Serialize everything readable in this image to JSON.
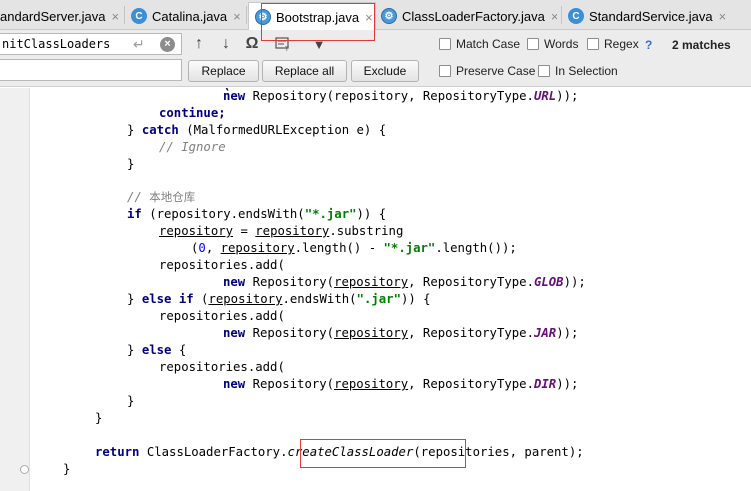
{
  "tabs": [
    {
      "label": "andardServer.java",
      "icon": "c",
      "active": false
    },
    {
      "label": "Catalina.java",
      "icon": "c",
      "active": false
    },
    {
      "label": "Bootstrap.java",
      "icon": "g",
      "active": true
    },
    {
      "label": "ClassLoaderFactory.java",
      "icon": "g",
      "active": false
    },
    {
      "label": "StandardService.java",
      "icon": "c",
      "active": false
    }
  ],
  "tab_close_glyph": "×",
  "find": {
    "search_value": "nitClassLoaders",
    "enter_glyph": "↵",
    "clear_glyph": "×",
    "toolbar": {
      "prev": "↑",
      "next": "↓",
      "find_word": "Ω",
      "filter": "▼"
    },
    "replace_label": "Replace",
    "replace_all_label": "Replace all",
    "exclude_label": "Exclude",
    "match_case": "Match Case",
    "words": "Words",
    "regex": "Regex",
    "help": "?",
    "matches": "2 matches",
    "preserve_case": "Preserve Case",
    "in_selection": "In Selection"
  },
  "code": {
    "l1_new": "new",
    "l1_rest": " Repository(repository, RepositoryType.",
    "l1_const": "URL",
    "l1_end": "));",
    "l2": "continue;",
    "l3_a": "} ",
    "l3_kw": "catch",
    "l3_b": " (MalformedURLException e) {",
    "l4": "// Ignore",
    "l5": "}",
    "l6_slashes": "// ",
    "l6_cn": "本地仓库",
    "l7_if": "if",
    "l7_a": " (repository.endsWith(",
    "l7_str": "\"*.jar\"",
    "l7_b": ")) {",
    "l8_a": "repository",
    "l8_b": " = ",
    "l8_c": "repository",
    "l8_d": ".substring",
    "l9_a": "(",
    "l9_num": "0",
    "l9_b": ", ",
    "l9_c": "repository",
    "l9_d": ".length() - ",
    "l9_str": "\"*.jar\"",
    "l9_e": ".length());",
    "l10": "repositories.add(",
    "l11_new": "new",
    "l11_a": " Repository(",
    "l11_b": "repository",
    "l11_c": ", RepositoryType.",
    "l11_const": "GLOB",
    "l11_end": "));",
    "l12_a": "} ",
    "l12_kw": "else if",
    "l12_b": " (",
    "l12_c": "repository",
    "l12_d": ".endsWith(",
    "l12_str": "\".jar\"",
    "l12_e": ")) {",
    "l13": "repositories.add(",
    "l14_new": "new",
    "l14_a": " Repository(",
    "l14_b": "repository",
    "l14_c": ", RepositoryType.",
    "l14_const": "JAR",
    "l14_end": "));",
    "l15_a": "} ",
    "l15_kw": "else",
    "l15_b": " {",
    "l16": "repositories.add(",
    "l17_new": "new",
    "l17_a": " Repository(",
    "l17_b": "repository",
    "l17_c": ", RepositoryType.",
    "l17_const": "DIR",
    "l17_end": "));",
    "l18": "}",
    "l19": "}",
    "l20_kw": "return",
    "l20_a": " ClassLoaderFactory.",
    "l20_m": "createClassLoader",
    "l20_b": "(repositories, parent);",
    "l21": "}"
  },
  "colors": {
    "keyword": "#000080",
    "constant": "#660e7a",
    "string": "#008000",
    "number": "#0000ff",
    "comment": "#808080",
    "annotation_box": "#e53935"
  }
}
